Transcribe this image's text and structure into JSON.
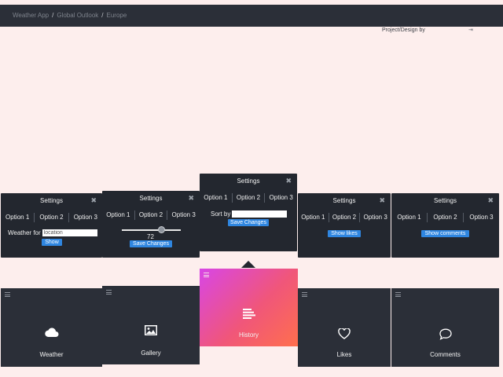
{
  "breadcrumb": [
    "Weather App",
    "Global Outlook",
    "Europe"
  ],
  "credit": {
    "text": "Project/Design by",
    "arrow": "⇥"
  },
  "panels": [
    {
      "title": "Settings",
      "close": "✖",
      "options": [
        "Option 1",
        "Option 2",
        "Option 3"
      ],
      "field_label": "Weather for",
      "field_value": "location",
      "button": "Show"
    },
    {
      "title": "Settings",
      "close": "✖",
      "options": [
        "Option 1",
        "Option 2",
        "Option 3"
      ],
      "slider_value": "72",
      "button": "Save Changes"
    },
    {
      "title": "Settings",
      "close": "✖",
      "options": [
        "Option 1",
        "Option 2",
        "Option 3"
      ],
      "field_label": "Sort by",
      "field_value": "",
      "button": "Save Changes"
    },
    {
      "title": "Settings",
      "close": "✖",
      "options": [
        "Option 1",
        "Option 2",
        "Option 3"
      ],
      "button": "Show likes"
    },
    {
      "title": "Settings",
      "close": "✖",
      "options": [
        "Option 1",
        "Option 2",
        "Option 3"
      ],
      "button": "Show comments"
    }
  ],
  "tiles": [
    {
      "label": "Weather",
      "icon": "cloud-icon"
    },
    {
      "label": "Gallery",
      "icon": "image-icon"
    },
    {
      "label": "History",
      "icon": "list-icon",
      "active": true
    },
    {
      "label": "Likes",
      "icon": "heart-icon"
    },
    {
      "label": "Comments",
      "icon": "chat-bubble-icon"
    }
  ],
  "colors": {
    "background": "#fdeeed",
    "panel": "#23272f",
    "tile": "#2b2f38",
    "accent": "#2f86e0",
    "active_gradient": [
      "#d846e6",
      "#ff6f4d"
    ]
  }
}
